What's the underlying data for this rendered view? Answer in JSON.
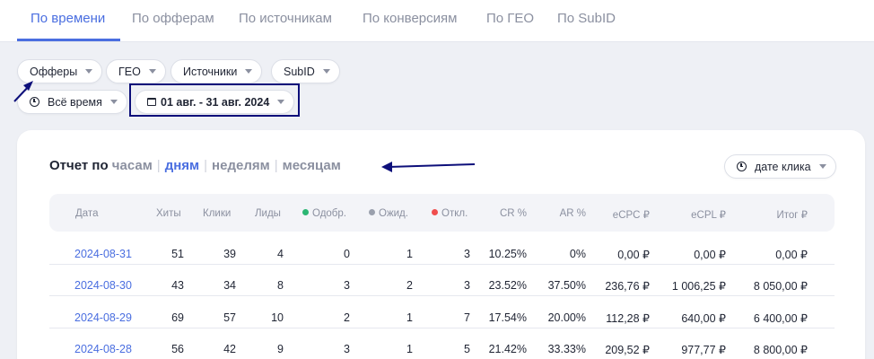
{
  "tabs": [
    {
      "label": "По времени",
      "active": true
    },
    {
      "label": "По офферам"
    },
    {
      "label": "По источникам"
    },
    {
      "label": "По конверсиям"
    },
    {
      "label": "По ГЕО"
    },
    {
      "label": "По SubID"
    }
  ],
  "filters": {
    "offers": "Офферы",
    "geo": "ГЕО",
    "sources": "Источники",
    "subid": "SubID",
    "time_range": "Всё время",
    "date_range": "01 авг. - 31 авг. 2024"
  },
  "report": {
    "title": "Отчет по",
    "periods": [
      "часам",
      "дням",
      "неделям",
      "месяцам"
    ],
    "active_period": "дням",
    "sort_by": "дате клика"
  },
  "table": {
    "headers": [
      "Дата",
      "Хиты",
      "Клики",
      "Лиды",
      "Одобр.",
      "Ожид.",
      "Откл.",
      "CR %",
      "AR %",
      "eCPC ₽",
      "eCPL ₽",
      "Итог ₽"
    ],
    "status_colors": {
      "approved": "#2bb673",
      "pending": "#9aa0ad",
      "rejected": "#f04e4e"
    },
    "rows": [
      [
        "2024-08-31",
        "51",
        "39",
        "4",
        "0",
        "1",
        "3",
        "10.25%",
        "0%",
        "0,00 ₽",
        "0,00 ₽",
        "0,00 ₽"
      ],
      [
        "2024-08-30",
        "43",
        "34",
        "8",
        "3",
        "2",
        "3",
        "23.52%",
        "37.50%",
        "236,76 ₽",
        "1 006,25 ₽",
        "8 050,00 ₽"
      ],
      [
        "2024-08-29",
        "69",
        "57",
        "10",
        "2",
        "1",
        "7",
        "17.54%",
        "20.00%",
        "112,28 ₽",
        "640,00 ₽",
        "6 400,00 ₽"
      ],
      [
        "2024-08-28",
        "56",
        "42",
        "9",
        "3",
        "1",
        "5",
        "21.42%",
        "33.33%",
        "209,52 ₽",
        "977,77 ₽",
        "8 800,00 ₽"
      ]
    ]
  },
  "accent_color": "#4a6ee0"
}
